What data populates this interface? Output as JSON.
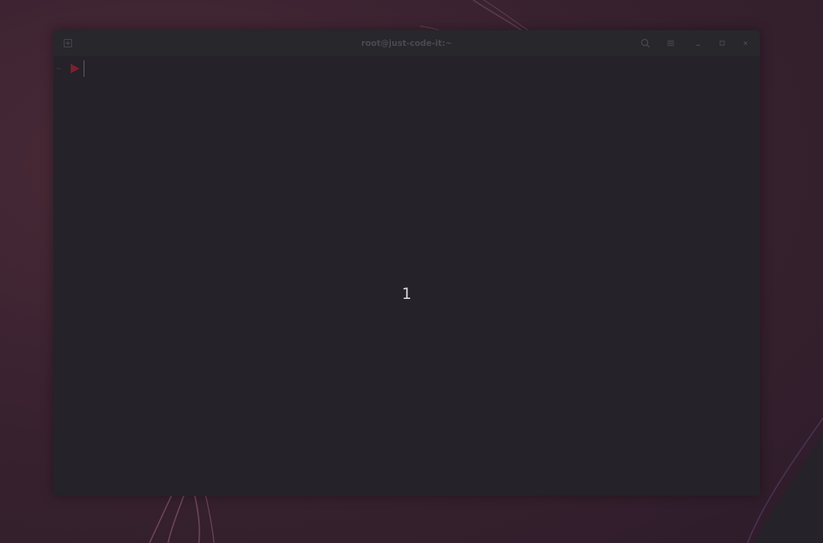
{
  "window": {
    "title": "root@just-code-it:~"
  },
  "terminal": {
    "prompt_dir": "~",
    "overlay_number": "1"
  },
  "icons": {
    "new_tab": "new-tab-icon",
    "search": "search-icon",
    "menu": "hamburger-menu-icon",
    "minimize": "minimize-icon",
    "maximize": "maximize-icon",
    "close": "close-icon",
    "prompt_arrow": "prompt-arrow-icon"
  },
  "colors": {
    "terminal_bg": "#252229",
    "titlebar_bg": "#27272c",
    "prompt_accent": "#7a2030",
    "wallpaper": "#3a2230"
  }
}
